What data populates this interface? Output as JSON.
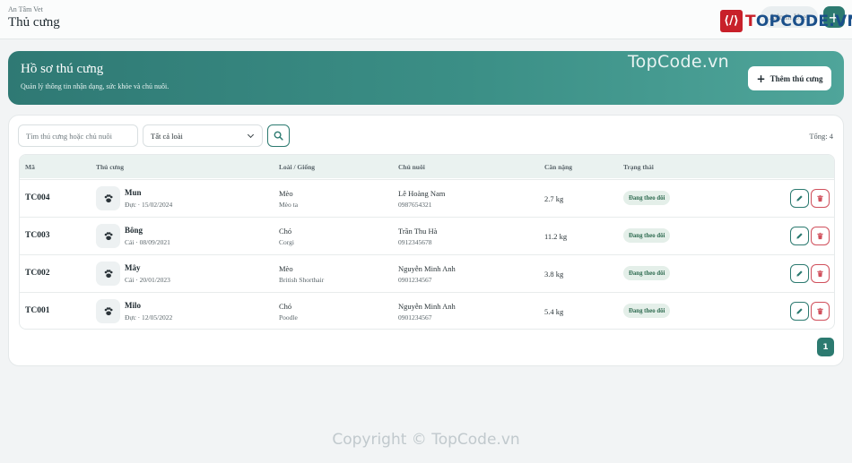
{
  "header": {
    "brand": "An Tâm Vet",
    "title": "Thủ cưng",
    "user_label": "Admin User",
    "add_symbol": "+"
  },
  "logo": {
    "mark": "⟨/⟩",
    "text_red": "T",
    "text_main": "OPCODE.VN"
  },
  "hero": {
    "title": "Hồ sơ thú cưng",
    "subtitle": "Quản lý thông tin nhận dạng, sức khỏe và chủ nuôi.",
    "add_button": "Thêm thú cưng",
    "plus": "+"
  },
  "watermarks": {
    "top": "TopCode.vn",
    "bottom": "Copyright © TopCode.vn"
  },
  "filters": {
    "search_placeholder": "Tìm thú cưng hoặc chủ nuôi",
    "type_selected": "Tất cả loài",
    "total": "Tổng: 4"
  },
  "table": {
    "headers": {
      "code": "Mã",
      "pet": "Thú cưng",
      "species": "Loài / Giống",
      "owner": "Chủ nuôi",
      "weight": "Cân nặng",
      "status": "Trạng thái"
    },
    "rows": [
      {
        "code": "TC004",
        "name": "Mun",
        "meta": "Đực · 15/02/2024",
        "species": "Mèo",
        "breed": "Mèo ta",
        "owner": "Lê Hoàng Nam",
        "phone": "0987654321",
        "weight": "2.7 kg",
        "status": "Đang theo dõi"
      },
      {
        "code": "TC003",
        "name": "Bông",
        "meta": "Cái · 08/09/2021",
        "species": "Chó",
        "breed": "Corgi",
        "owner": "Trần Thu Hà",
        "phone": "0912345678",
        "weight": "11.2 kg",
        "status": "Đang theo dõi"
      },
      {
        "code": "TC002",
        "name": "Mây",
        "meta": "Cái · 20/01/2023",
        "species": "Mèo",
        "breed": "British Shorthair",
        "owner": "Nguyễn Minh Anh",
        "phone": "0901234567",
        "weight": "3.8 kg",
        "status": "Đang theo dõi"
      },
      {
        "code": "TC001",
        "name": "Milo",
        "meta": "Đực · 12/05/2022",
        "species": "Chó",
        "breed": "Poodle",
        "owner": "Nguyễn Minh Anh",
        "phone": "0901234567",
        "weight": "5.4 kg",
        "status": "Đang theo dõi"
      }
    ]
  },
  "pagination": {
    "current": "1"
  },
  "icons": {
    "search": "search-icon",
    "paw": "paw-icon",
    "edit": "pencil-icon",
    "delete": "trash-icon",
    "chevron": "chevron-down-icon"
  },
  "colors": {
    "primary": "#2c7a70",
    "danger": "#d0505c",
    "status_bg": "#e4efe9",
    "status_text": "#2d6a4f"
  }
}
